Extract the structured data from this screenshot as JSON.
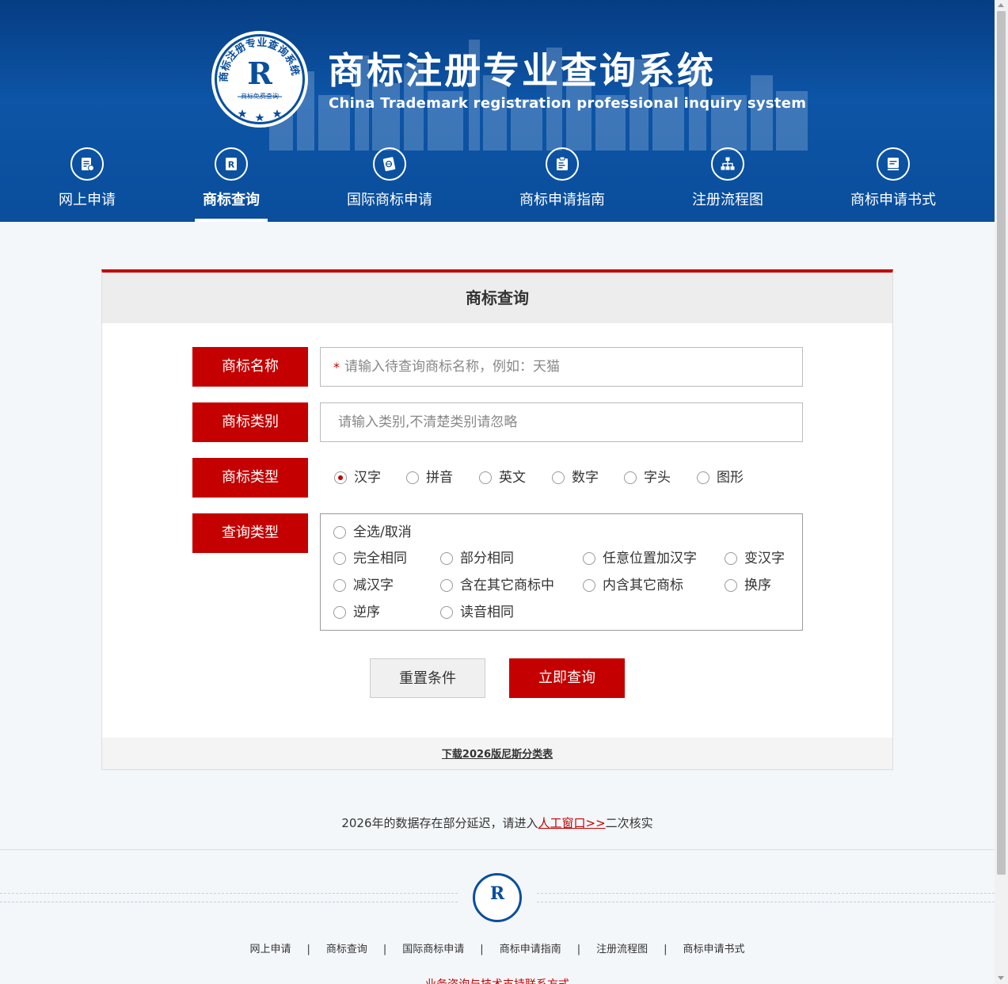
{
  "header": {
    "title": "商标注册专业查询系统",
    "subtitle": "China Trademark registration professional inquiry system",
    "logo_letter": "R",
    "logo_ring_text": "商标注册专业查询系统",
    "logo_small_text": "商标免费查询"
  },
  "nav": [
    {
      "label": "网上申请",
      "icon": "document-edit-icon"
    },
    {
      "label": "商标查询",
      "icon": "registered-search-icon",
      "active": true
    },
    {
      "label": "国际商标申请",
      "icon": "globe-doc-icon"
    },
    {
      "label": "商标申请指南",
      "icon": "clipboard-icon"
    },
    {
      "label": "注册流程图",
      "icon": "flowchart-icon"
    },
    {
      "label": "商标申请书式",
      "icon": "form-doc-icon"
    }
  ],
  "card": {
    "title": "商标查询",
    "name_label": "商标名称",
    "name_placeholder": "请输入待查询商标名称，例如：天猫",
    "name_required_mark": "*",
    "class_label": "商标类别",
    "class_placeholder": "请输入类别,不清楚类别请忽略",
    "mark_type_label": "商标类型",
    "mark_types": [
      {
        "label": "汉字",
        "checked": true
      },
      {
        "label": "拼音",
        "checked": false
      },
      {
        "label": "英文",
        "checked": false
      },
      {
        "label": "数字",
        "checked": false
      },
      {
        "label": "字头",
        "checked": false
      },
      {
        "label": "图形",
        "checked": false
      }
    ],
    "query_type_label": "查询类型",
    "select_all": "全选/取消",
    "query_types": [
      "完全相同",
      "部分相同",
      "任意位置加汉字",
      "变汉字",
      "减汉字",
      "含在其它商标中",
      "内含其它商标",
      "换序",
      "逆序",
      "读音相同"
    ],
    "reset_button": "重置条件",
    "submit_button": "立即查询",
    "download_link": "下载2026版尼斯分类表"
  },
  "notice": {
    "prefix": "2026年的数据存在部分延迟，请进入",
    "link": "人工窗口>>",
    "suffix": "二次核实"
  },
  "footer": {
    "nav": [
      "网上申请",
      "商标查询",
      "国际商标申请",
      "商标申请指南",
      "注册流程图",
      "商标申请书式"
    ],
    "separator": "|",
    "contact": "业务咨询与技术支持联系方式"
  }
}
